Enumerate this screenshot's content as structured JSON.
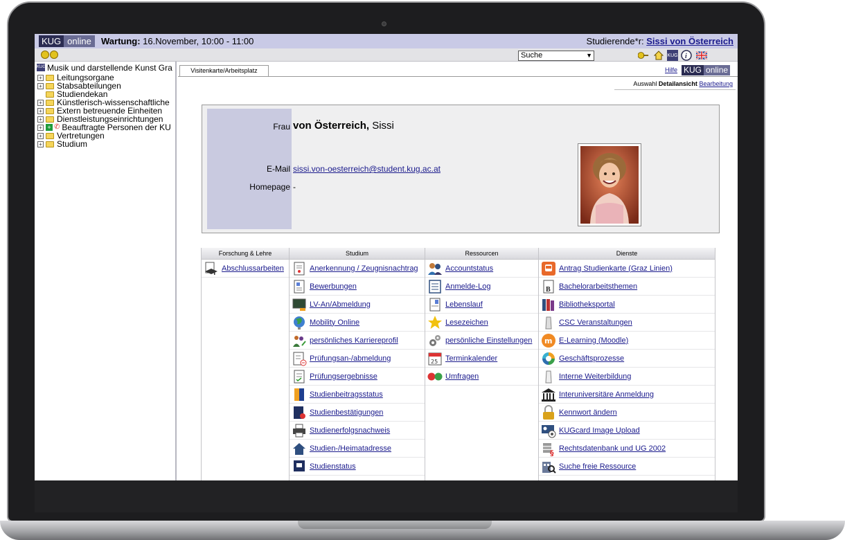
{
  "topbar": {
    "brand_kug": "KUG",
    "brand_online": "online",
    "maintenance_label": "Wartung:",
    "maintenance_text": " 16.November, 10:00 - 11:00",
    "student_label": "Studierende*r: ",
    "student_name": "Sissi von Österreich"
  },
  "toolbar": {
    "search_selected": "Suche",
    "kug_small": "KUG"
  },
  "sidebar": {
    "root_label": "Musik und darstellende Kunst Gra",
    "items": [
      {
        "label": "Leitungsorgane",
        "expandable": true
      },
      {
        "label": "Stabsabteilungen",
        "expandable": true
      },
      {
        "label": "Studiendekan",
        "expandable": false
      },
      {
        "label": "Künstlerisch-wissenschaftliche",
        "expandable": true
      },
      {
        "label": "Extern betreuende Einheiten",
        "expandable": true
      },
      {
        "label": "Dienstleistungseinrichtungen",
        "expandable": true
      },
      {
        "label": "Beauftragte Personen der KU",
        "expandable": true
      },
      {
        "label": "Vertretungen",
        "expandable": true
      },
      {
        "label": "Studium",
        "expandable": true
      }
    ]
  },
  "content": {
    "tab_label": "Visitenkarte/Arbeitsplatz",
    "help_link": "Hilfe",
    "brand_kug": "KUG",
    "brand_online": "online",
    "mode_auswahl": "Auswahl",
    "mode_detail": "Detailansicht",
    "mode_bearbeitung": "Bearbeitung"
  },
  "card": {
    "salutation": "Frau",
    "surname": "von Österreich,",
    "firstname": " Sissi",
    "email_label": "E-Mail",
    "email": "sissi.von-oesterreich@student.kug.ac.at",
    "homepage_label": "Homepage",
    "homepage": "-"
  },
  "grid": {
    "columns": [
      {
        "header": "Forschung & Lehre",
        "links": [
          "Abschlussarbeiten"
        ]
      },
      {
        "header": "Studium",
        "links": [
          "Anerkennung / Zeugnisnachtrag",
          "Bewerbungen",
          "LV-An/Abmeldung",
          "Mobility Online",
          "persönliches Karriereprofil",
          "Prüfungsan-/abmeldung",
          "Prüfungsergebnisse",
          "Studienbeitragsstatus",
          "Studienbestätigungen",
          "Studienerfolgsnachweis",
          "Studien-/Heimatadresse",
          "Studienstatus"
        ]
      },
      {
        "header": "Ressourcen",
        "links": [
          "Accountstatus",
          "Anmelde-Log",
          "Lebenslauf",
          "Lesezeichen",
          "persönliche Einstellungen",
          "Terminkalender",
          "Umfragen"
        ]
      },
      {
        "header": "Dienste",
        "links": [
          "Antrag Studienkarte (Graz Linien)",
          "Bachelorarbeitsthemen",
          "Bibliotheksportal",
          "CSC Veranstaltungen",
          "E-Learning (Moodle)",
          "Geschäftsprozesse",
          "Interne Weiterbildung",
          "Interuniversitäre Anmeldung",
          "Kennwort ändern",
          "KUGcard Image Upload",
          "Rechtsdatenbank und UG 2002",
          "Suche freie Ressource"
        ]
      }
    ]
  },
  "colors": {
    "topbar_bg": "#c9cae6",
    "brand_dark": "#2b2c52",
    "link": "#1a1a8c"
  }
}
